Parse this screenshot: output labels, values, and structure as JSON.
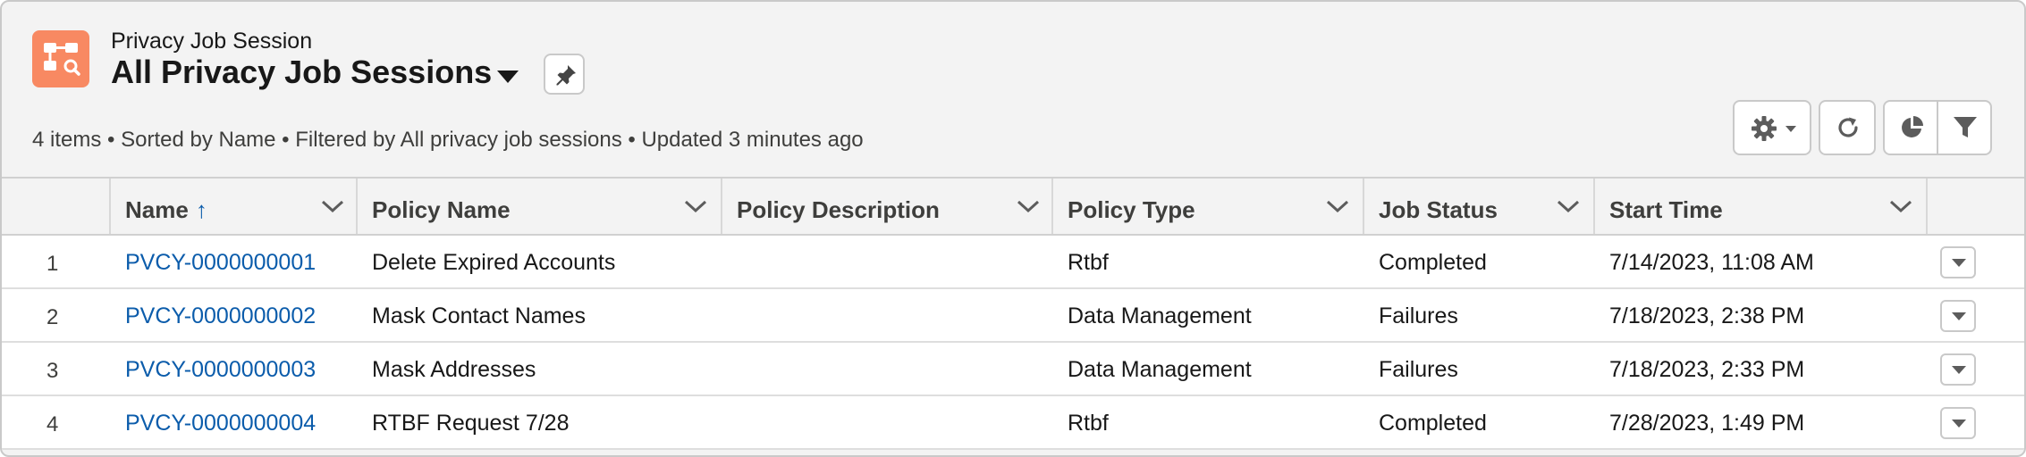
{
  "header": {
    "object_label": "Privacy Job Session",
    "list_title": "All Privacy Job Sessions",
    "meta": "4 items • Sorted by Name • Filtered by All privacy job sessions • Updated 3 minutes ago",
    "icons": {
      "object": "privacy-job-icon",
      "title_menu": "chevron-down-icon",
      "pin": "pin-icon",
      "settings": "gear-icon",
      "refresh": "refresh-icon",
      "chart": "pie-chart-icon",
      "filter": "filter-icon"
    }
  },
  "table": {
    "columns": [
      {
        "key": "name",
        "label": "Name",
        "sort_indicator": "↑"
      },
      {
        "key": "policy_name",
        "label": "Policy Name"
      },
      {
        "key": "policy_description",
        "label": "Policy Description"
      },
      {
        "key": "policy_type",
        "label": "Policy Type"
      },
      {
        "key": "job_status",
        "label": "Job Status"
      },
      {
        "key": "start_time",
        "label": "Start Time"
      }
    ],
    "rows": [
      {
        "num": "1",
        "name": "PVCY-0000000001",
        "policy_name": "Delete Expired Accounts",
        "policy_description": "",
        "policy_type": "Rtbf",
        "job_status": "Completed",
        "start_time": "7/14/2023, 11:08 AM"
      },
      {
        "num": "2",
        "name": "PVCY-0000000002",
        "policy_name": "Mask Contact Names",
        "policy_description": "",
        "policy_type": "Data Management",
        "job_status": "Failures",
        "start_time": "7/18/2023, 2:38 PM"
      },
      {
        "num": "3",
        "name": "PVCY-0000000003",
        "policy_name": "Mask Addresses",
        "policy_description": "",
        "policy_type": "Data Management",
        "job_status": "Failures",
        "start_time": "7/18/2023, 2:33 PM"
      },
      {
        "num": "4",
        "name": "PVCY-0000000004",
        "policy_name": "RTBF Request 7/28",
        "policy_description": "",
        "policy_type": "Rtbf",
        "job_status": "Completed",
        "start_time": "7/28/2023, 1:49 PM"
      }
    ],
    "row_action_icon": "chevron-down-icon"
  },
  "colors": {
    "object_icon": "#f88962",
    "link": "#0b5cab",
    "header_bg": "#f3f3f3",
    "border": "#c9c9c9"
  }
}
